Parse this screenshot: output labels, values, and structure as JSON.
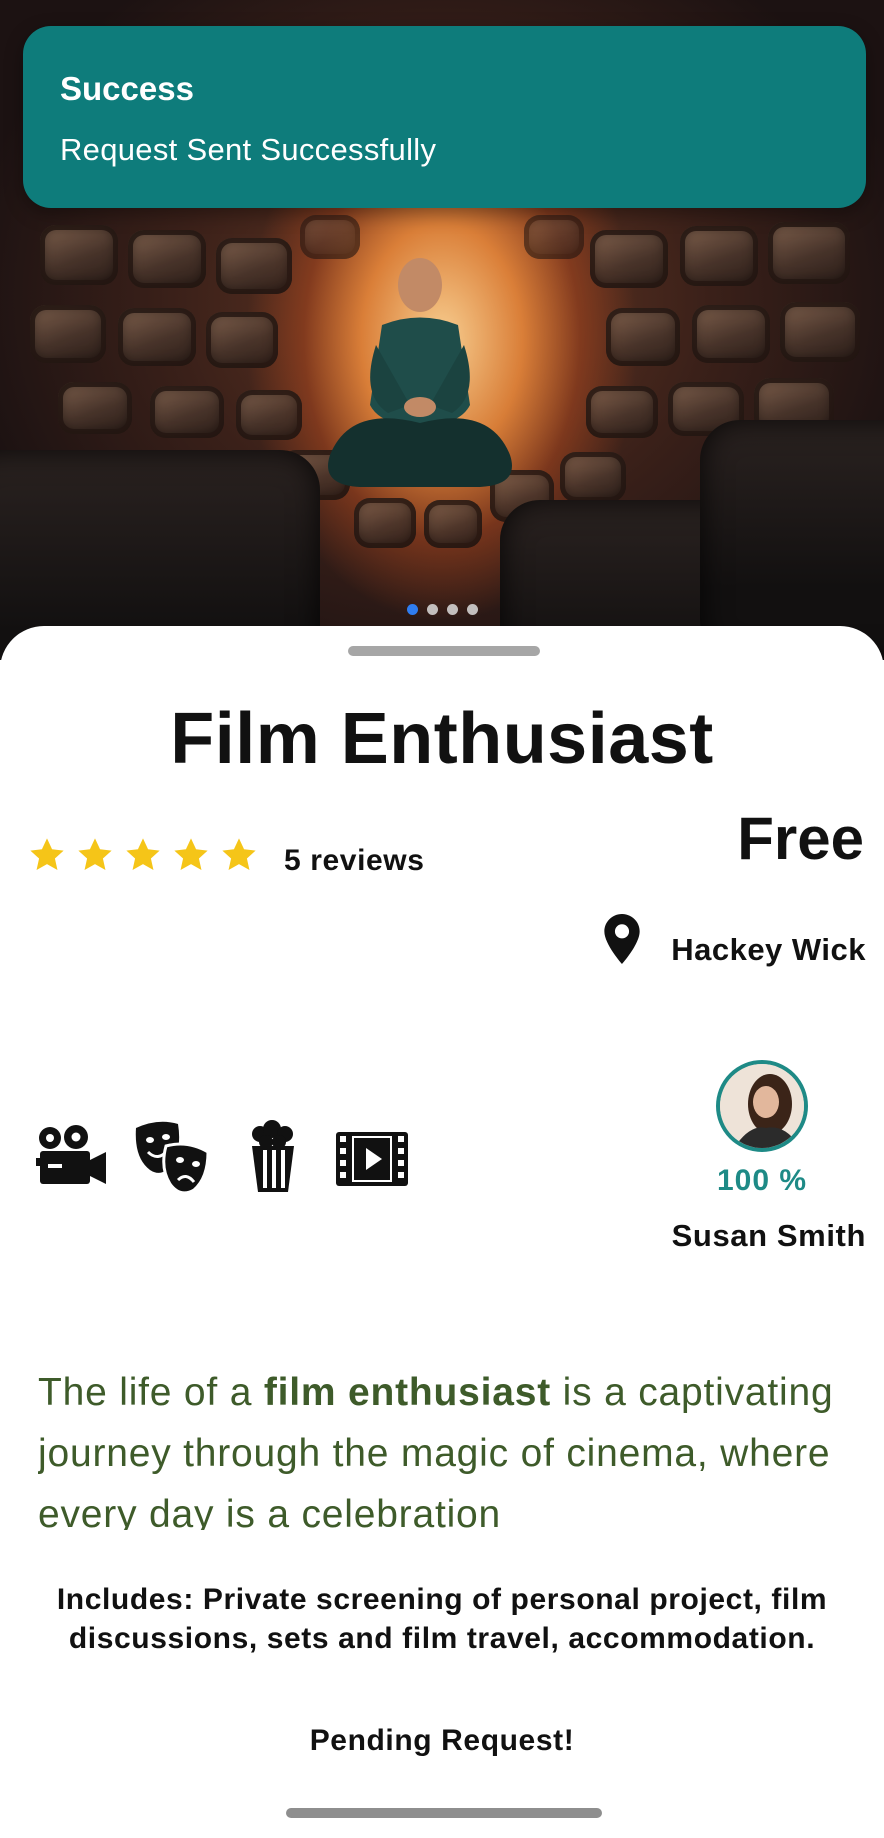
{
  "toast": {
    "title": "Success",
    "message": "Request Sent Successfully",
    "color": "#0e7c7b"
  },
  "hero": {
    "carousel_pages": 4,
    "active_page": 1
  },
  "listing": {
    "title": "Film Enthusiast",
    "rating": 5,
    "rating_max": 5,
    "reviews_label": "5 reviews",
    "price": "Free",
    "location": "Hackey Wick",
    "category_icons": [
      "film-camera-icon",
      "theatre-masks-icon",
      "popcorn-icon",
      "film-play-icon"
    ],
    "host": {
      "match": "100 %",
      "name": "Susan Smith"
    },
    "description": {
      "part1": "The life of a ",
      "highlight": "film enthusiast",
      "part2": " is a captivating journey through the magic of cinema, where every day is a celebration"
    },
    "includes": "Includes: Private screening of personal project, film discussions, sets and film travel, accommodation.",
    "status": "Pending Request!"
  },
  "colors": {
    "accent": "#1e8a86",
    "star": "#f5c518",
    "description_text": "#3e5b2a",
    "active_dot": "#2f7df0"
  }
}
